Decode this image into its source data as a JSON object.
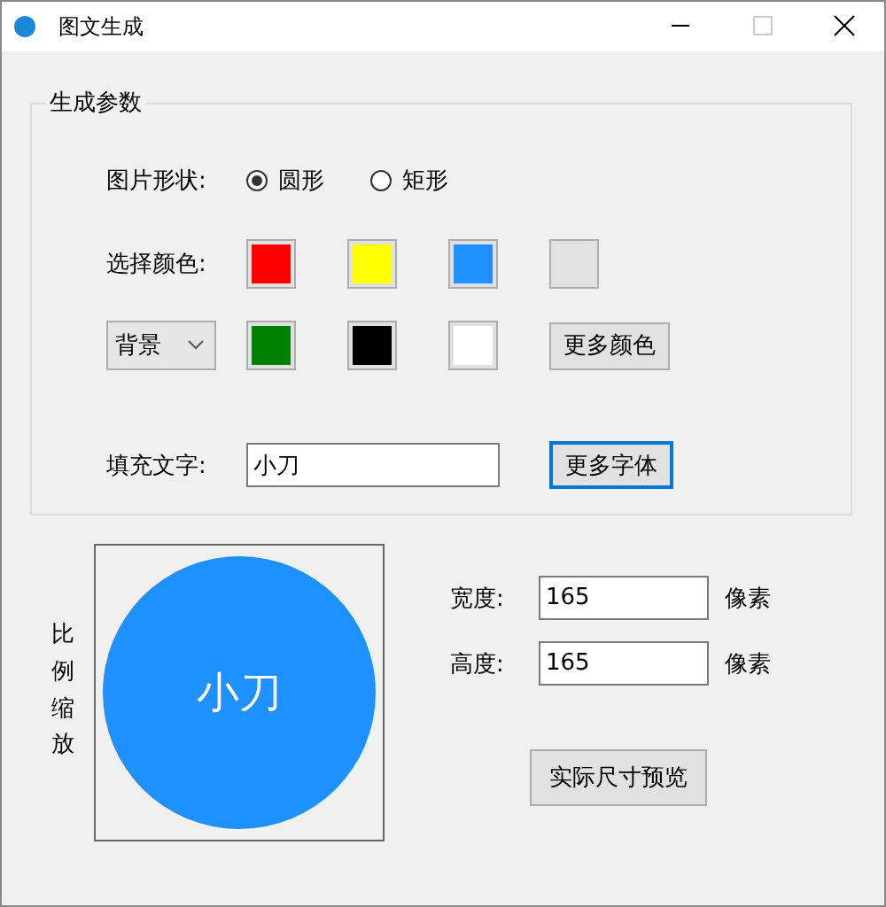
{
  "window": {
    "title": "图文生成"
  },
  "group": {
    "title": "生成参数"
  },
  "shape": {
    "label": "图片形状:",
    "options": [
      {
        "label": "圆形",
        "selected": true
      },
      {
        "label": "矩形",
        "selected": false
      }
    ]
  },
  "colors": {
    "label": "选择颜色:",
    "target": "背景",
    "swatches": [
      {
        "color": "#ff0000"
      },
      {
        "color": "#ffff00"
      },
      {
        "color": "#1e90ff"
      },
      {
        "color": "#e3e3e3"
      },
      {
        "color": "#008000"
      },
      {
        "color": "#000000"
      },
      {
        "color": "#ffffff"
      }
    ],
    "more_button": "更多颜色"
  },
  "fill_text": {
    "label": "填充文字:",
    "value": "小刀",
    "more_button": "更多字体"
  },
  "preview": {
    "side_label": "比例缩放",
    "color": "#1e90ff",
    "text": "小刀"
  },
  "size": [
    {
      "label": "宽度:",
      "value": "165",
      "unit": "像素"
    },
    {
      "label": "高度:",
      "value": "165",
      "unit": "像素"
    }
  ],
  "preview_button": "实际尺寸预览"
}
